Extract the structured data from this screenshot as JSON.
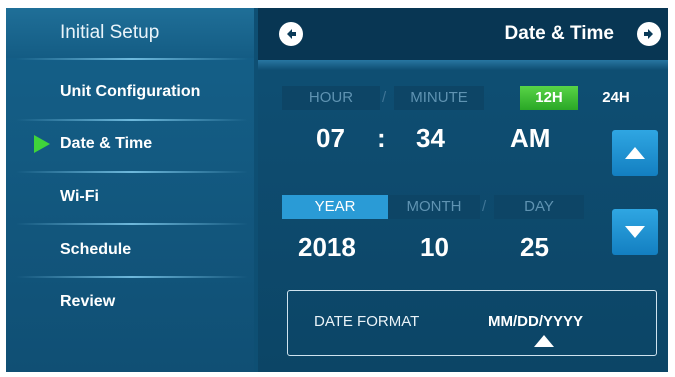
{
  "sidebar": {
    "title": "Initial Setup",
    "items": [
      {
        "label": "Unit Configuration"
      },
      {
        "label": "Date & Time",
        "active": true
      },
      {
        "label": "Wi-Fi"
      },
      {
        "label": "Schedule"
      },
      {
        "label": "Review"
      }
    ]
  },
  "header": {
    "title": "Date & Time",
    "back_icon": "circle-arrow-left-icon",
    "forward_icon": "circle-arrow-right-icon"
  },
  "time": {
    "hour_label": "HOUR",
    "minute_label": "MINUTE",
    "separator": "/",
    "hour": "07",
    "colon": ":",
    "minute": "34",
    "ampm": "AM",
    "mode_12h": "12H",
    "mode_24h": "24H",
    "selected_mode": "12H"
  },
  "date": {
    "year_label": "YEAR",
    "month_label": "MONTH",
    "day_label": "DAY",
    "separator": "/",
    "year": "2018",
    "month": "10",
    "day": "25",
    "selected_field": "YEAR"
  },
  "controls": {
    "up_icon": "triangle-up-icon",
    "down_icon": "triangle-down-icon"
  },
  "date_format": {
    "label": "DATE FORMAT",
    "value": "MM/DD/YYYY"
  },
  "colors": {
    "accent_green": "#3fd43a",
    "accent_blue": "#2a9bd6",
    "background": "#0e4f73"
  }
}
